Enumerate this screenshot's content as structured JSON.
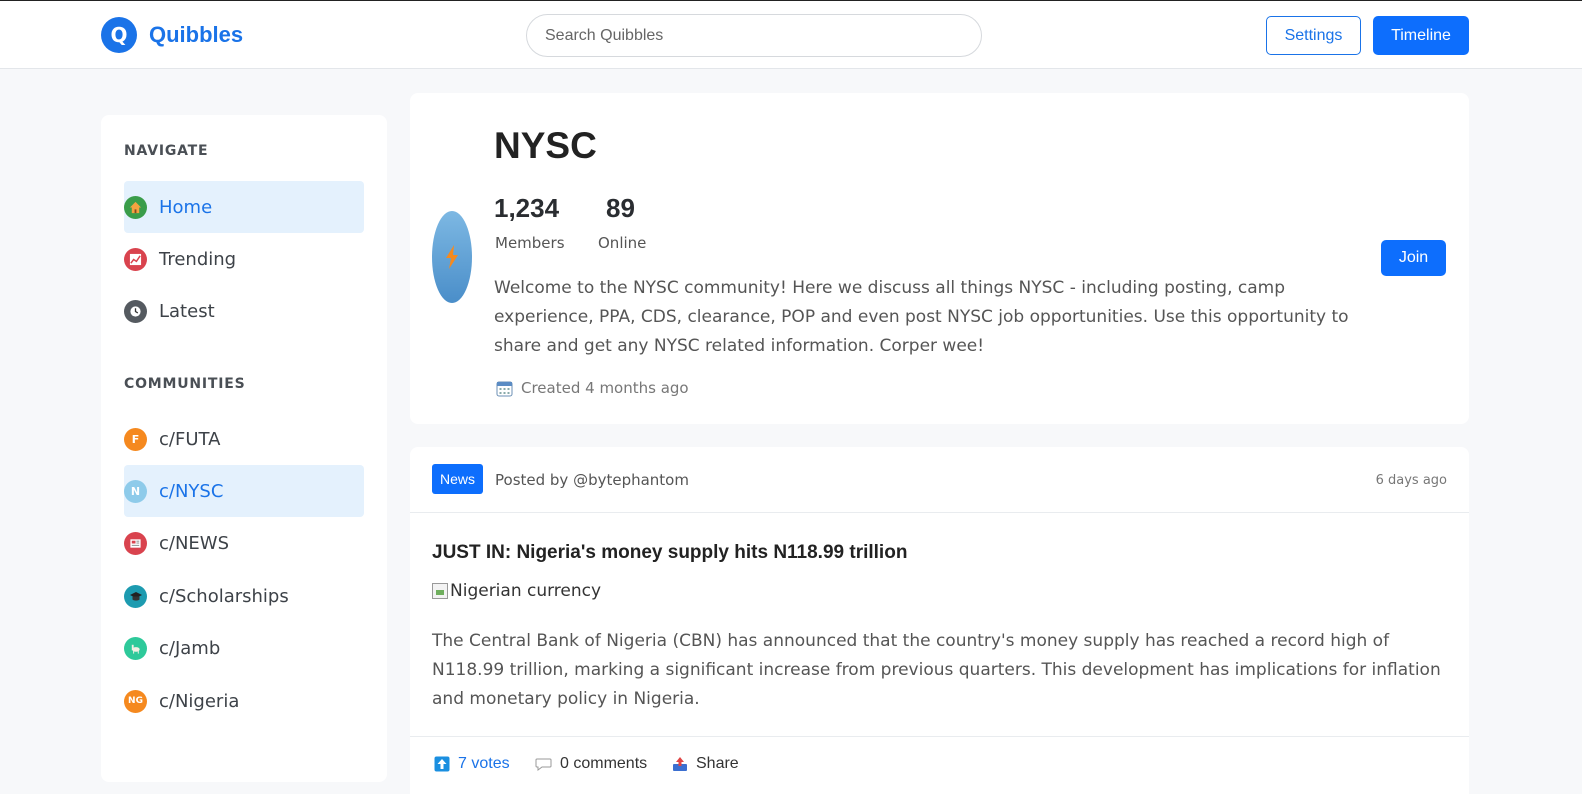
{
  "header": {
    "logo_letter": "Q",
    "app_name": "Quibbles",
    "search_placeholder": "Search Quibbles",
    "settings_label": "Settings",
    "timeline_label": "Timeline",
    "accent": "#1a73e8"
  },
  "sidebar": {
    "navigate_title": "NAVIGATE",
    "nav": [
      {
        "label": "Home",
        "icon": "home-icon",
        "active": true
      },
      {
        "label": "Trending",
        "icon": "trending-icon",
        "active": false
      },
      {
        "label": "Latest",
        "icon": "clock-icon",
        "active": false
      }
    ],
    "communities_title": "COMMUNITIES",
    "communities": [
      {
        "label": "c/FUTA",
        "icon_text": "F",
        "color": "#f5891f",
        "active": false
      },
      {
        "label": "c/NYSC",
        "icon_text": "N",
        "color": "#8ecbea",
        "active": true
      },
      {
        "label": "c/NEWS",
        "icon": "newspaper-icon",
        "color": "#d9434e",
        "active": false
      },
      {
        "label": "c/Scholarships",
        "icon": "graduation-cap-icon",
        "color": "#1d9bb0",
        "active": false
      },
      {
        "label": "c/Jamb",
        "icon": "llama-icon",
        "color": "#2ec99a",
        "active": false
      },
      {
        "label": "c/Nigeria",
        "icon_text": "NG",
        "color": "#f5891f",
        "active": false
      }
    ]
  },
  "community": {
    "name": "NYSC",
    "members_count": "1,234",
    "members_label": "Members",
    "online_count": "89",
    "online_label": "Online",
    "description": "Welcome to the NYSC community! Here we discuss all things NYSC - including posting, camp experience, PPA, CDS, clearance, POP and even post NYSC job opportunities. Use this opportunity to share and get any NYSC related information. Corper wee!",
    "created": "Created 4 months ago",
    "join_label": "Join"
  },
  "post": {
    "tag": "News",
    "posted_by": "Posted by @bytephantom",
    "time": "6 days ago",
    "title": "JUST IN: Nigeria's money supply hits N118.99 trillion",
    "image_alt": "Nigerian currency",
    "body": "The Central Bank of Nigeria (CBN) has announced that the country's money supply has reached a record high of N118.99 trillion, marking a significant increase from previous quarters. This development has implications for inflation and monetary policy in Nigeria.",
    "votes": "7 votes",
    "comments": "0 comments",
    "share": "Share"
  }
}
